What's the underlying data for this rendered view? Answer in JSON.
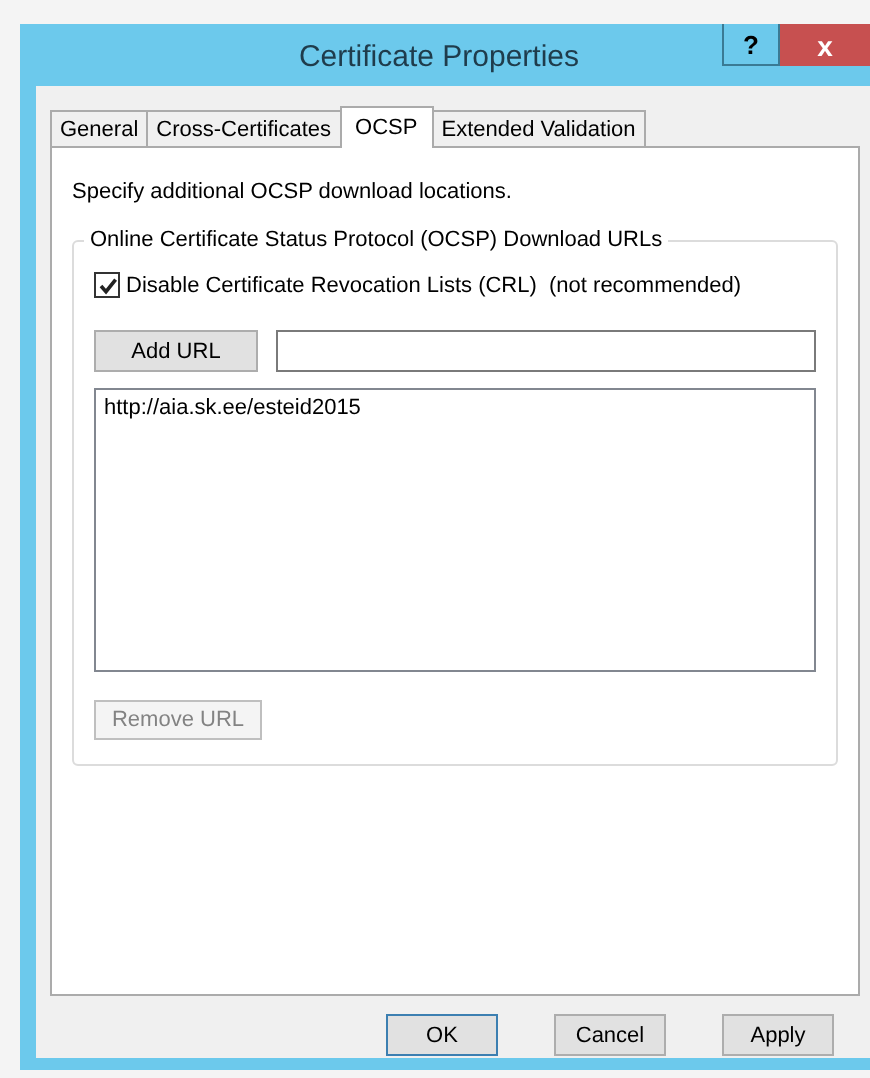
{
  "window": {
    "title": "Certificate Properties",
    "help_button": "?",
    "close_button": "x"
  },
  "tabs": [
    {
      "label": "General",
      "selected": false
    },
    {
      "label": "Cross-Certificates",
      "selected": false
    },
    {
      "label": "OCSP",
      "selected": true
    },
    {
      "label": "Extended Validation",
      "selected": false
    }
  ],
  "description": "Specify additional OCSP download locations.",
  "group": {
    "title": "Online Certificate Status Protocol (OCSP) Download URLs",
    "checkbox": {
      "label": "Disable Certificate Revocation Lists (CRL)  (not recommended)",
      "checked": true
    },
    "add_button": {
      "label": "Add URL",
      "disabled": false
    },
    "url_list": [
      "http://aia.sk.ee/esteid2015"
    ],
    "remove_button": {
      "label": "Remove URL",
      "disabled": true
    }
  },
  "buttons": [
    {
      "label": "OK",
      "default": true
    },
    {
      "label": "Cancel",
      "default": false
    },
    {
      "label": "Apply",
      "default": false
    }
  ]
}
